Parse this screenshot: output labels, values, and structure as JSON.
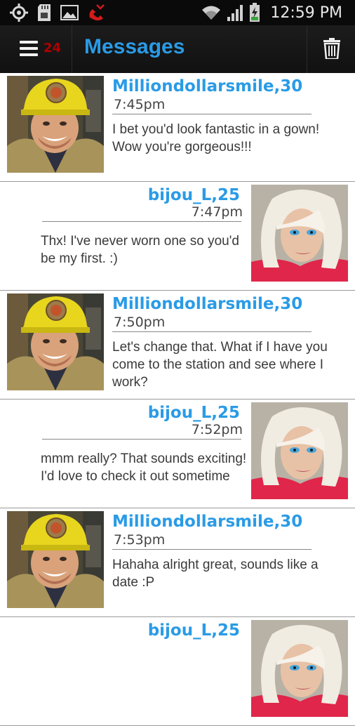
{
  "status_bar": {
    "time": "12:59 PM",
    "icons": [
      "gps-icon",
      "sd-card-icon",
      "gallery-icon",
      "missed-call-icon",
      "wifi-icon",
      "signal-icon",
      "battery-charging-icon"
    ]
  },
  "action_bar": {
    "menu_icon": "hamburger-menu-icon",
    "unread_count": "24",
    "title": "Messages",
    "delete_icon": "trash-icon"
  },
  "messages": [
    {
      "side": "left",
      "avatar": "firefighter-avatar",
      "name": "Milliondollarsmile,30",
      "time": "7:45pm",
      "text": "I bet you'd look fantastic in a gown! Wow you're gorgeous!!!"
    },
    {
      "side": "right",
      "avatar": "blonde-woman-avatar",
      "name": "bijou_L,25",
      "time": "7:47pm",
      "text": "Thx! I've never worn one so you'd be my first. :)"
    },
    {
      "side": "left",
      "avatar": "firefighter-avatar",
      "name": "Milliondollarsmile,30",
      "time": "7:50pm",
      "text": "Let's change that. What if I have you come to the station and see where I work?"
    },
    {
      "side": "right",
      "avatar": "blonde-woman-avatar",
      "name": "bijou_L,25",
      "time": "7:52pm",
      "text": "mmm really? That sounds exciting! I'd love to check it out sometime"
    },
    {
      "side": "left",
      "avatar": "firefighter-avatar",
      "name": "Milliondollarsmile,30",
      "time": "7:53pm",
      "text": "Hahaha alright great, sounds like a date :P"
    },
    {
      "side": "right",
      "avatar": "blonde-woman-avatar",
      "name": "bijou_L,25",
      "time": "",
      "text": ""
    }
  ],
  "colors": {
    "accent": "#2a9be6",
    "badge": "#b00000",
    "action_bar": "#161616",
    "status_bar": "#0a0a0a"
  }
}
